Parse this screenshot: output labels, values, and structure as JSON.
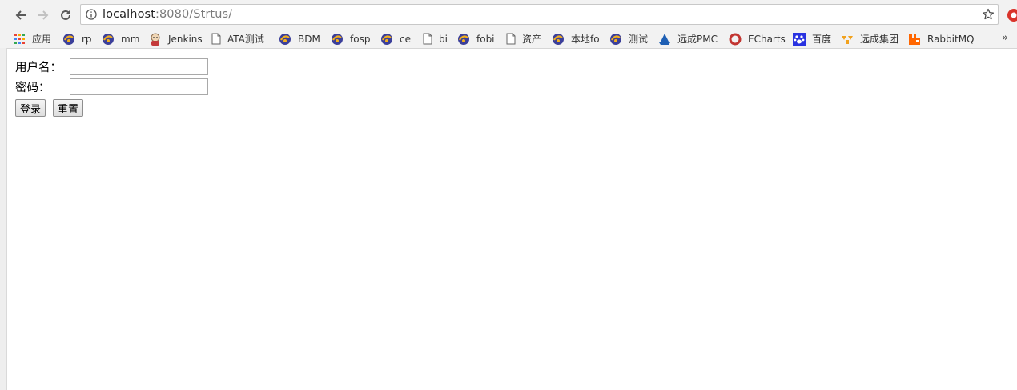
{
  "browser": {
    "url_host": "localhost",
    "url_path": ":8080/Strtus/",
    "bookmarks": [
      "应用",
      "rp",
      "mm",
      "Jenkins",
      "ATA测试",
      "BDM",
      "fosp",
      "ce",
      "bi",
      "fobi",
      "资产",
      "本地fo",
      "测试",
      "远成PMC",
      "ECharts",
      "百度",
      "远成集团",
      "RabbitMQ"
    ],
    "bookmarks_more": "»"
  },
  "form": {
    "username_label": "用户名：",
    "password_label": "密码：",
    "login_button": "登录",
    "reset_button": "重置"
  }
}
